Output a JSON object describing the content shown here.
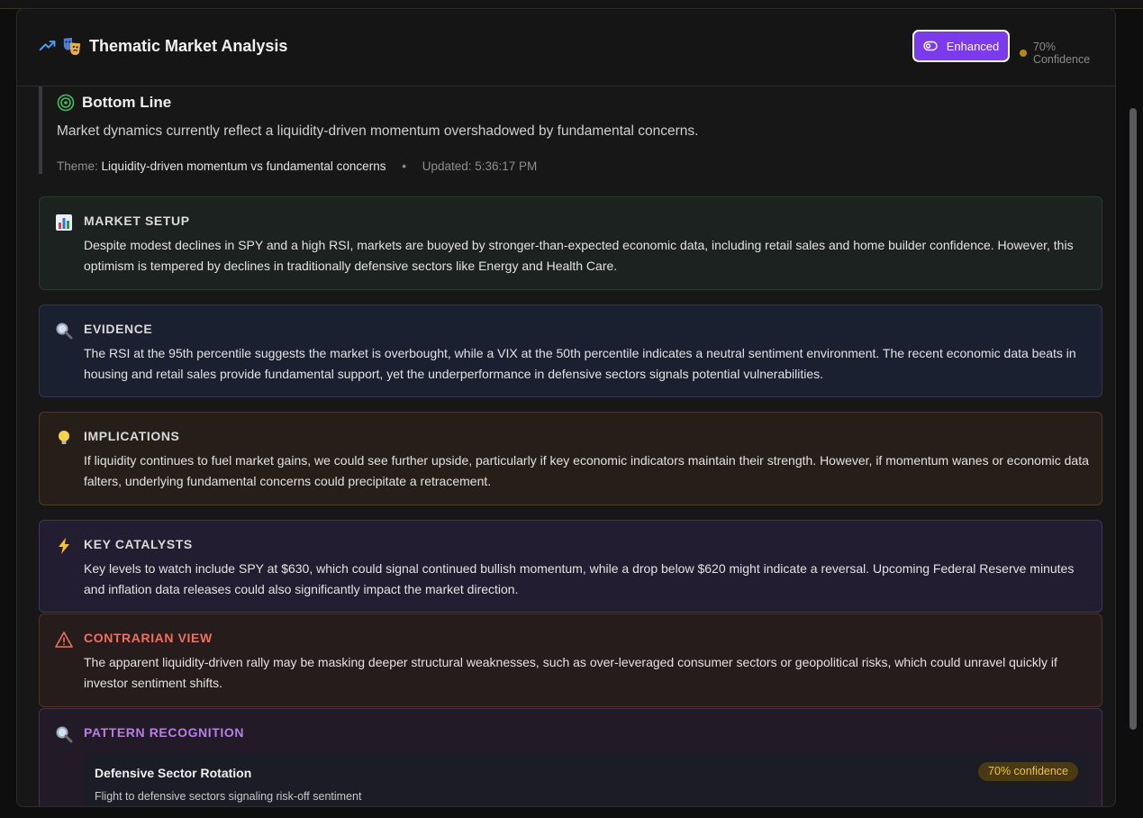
{
  "header": {
    "title": "Thematic Market Analysis",
    "enhanced_label": "Enhanced",
    "confidence": "70% Confidence"
  },
  "bottom_line": {
    "title": "Bottom Line",
    "text": "Market dynamics currently reflect a liquidity-driven momentum overshadowed by fundamental concerns.",
    "theme_label": "Theme:",
    "theme_value": "Liquidity-driven momentum vs fundamental concerns",
    "separator": "•",
    "updated": "Updated: 5:36:17 PM"
  },
  "sections": [
    {
      "title": "MARKET SETUP",
      "icon": "bar-chart-icon",
      "body": "Despite modest declines in SPY and a high RSI, markets are buoyed by stronger-than-expected economic data, including retail sales and home builder confidence. However, this optimism is tempered by declines in traditionally defensive sectors like Energy and Health Care."
    },
    {
      "title": "EVIDENCE",
      "icon": "magnifier-icon",
      "body": "The RSI at the 95th percentile suggests the market is overbought, while a VIX at the 50th percentile indicates a neutral sentiment environment. The recent economic data beats in housing and retail sales provide fundamental support, yet the underperformance in defensive sectors signals potential vulnerabilities."
    },
    {
      "title": "IMPLICATIONS",
      "icon": "lightbulb-icon",
      "body": "If liquidity continues to fuel market gains, we could see further upside, particularly if key economic indicators maintain their strength. However, if momentum wanes or economic data falters, underlying fundamental concerns could precipitate a retracement."
    },
    {
      "title": "KEY CATALYSTS",
      "icon": "lightning-icon",
      "body": "Key levels to watch include SPY at $630, which could signal continued bullish momentum, while a drop below $620 might indicate a reversal. Upcoming Federal Reserve minutes and inflation data releases could also significantly impact the market direction."
    },
    {
      "title": "CONTRARIAN VIEW",
      "icon": "warning-icon",
      "body": "The apparent liquidity-driven rally may be masking deeper structural weaknesses, such as over-leveraged consumer sectors or geopolitical risks, which could unravel quickly if investor sentiment shifts."
    },
    {
      "title": "PATTERN RECOGNITION",
      "icon": "magnifier-icon"
    }
  ],
  "pattern": {
    "name": "Defensive Sector Rotation",
    "confidence": "70% confidence",
    "description": "Flight to defensive sectors signaling risk-off sentiment"
  },
  "colors": {
    "accent": "#7c3aed",
    "contrarian": "#f07060",
    "pattern": "#b77ee6",
    "badge": "#f2c232"
  }
}
